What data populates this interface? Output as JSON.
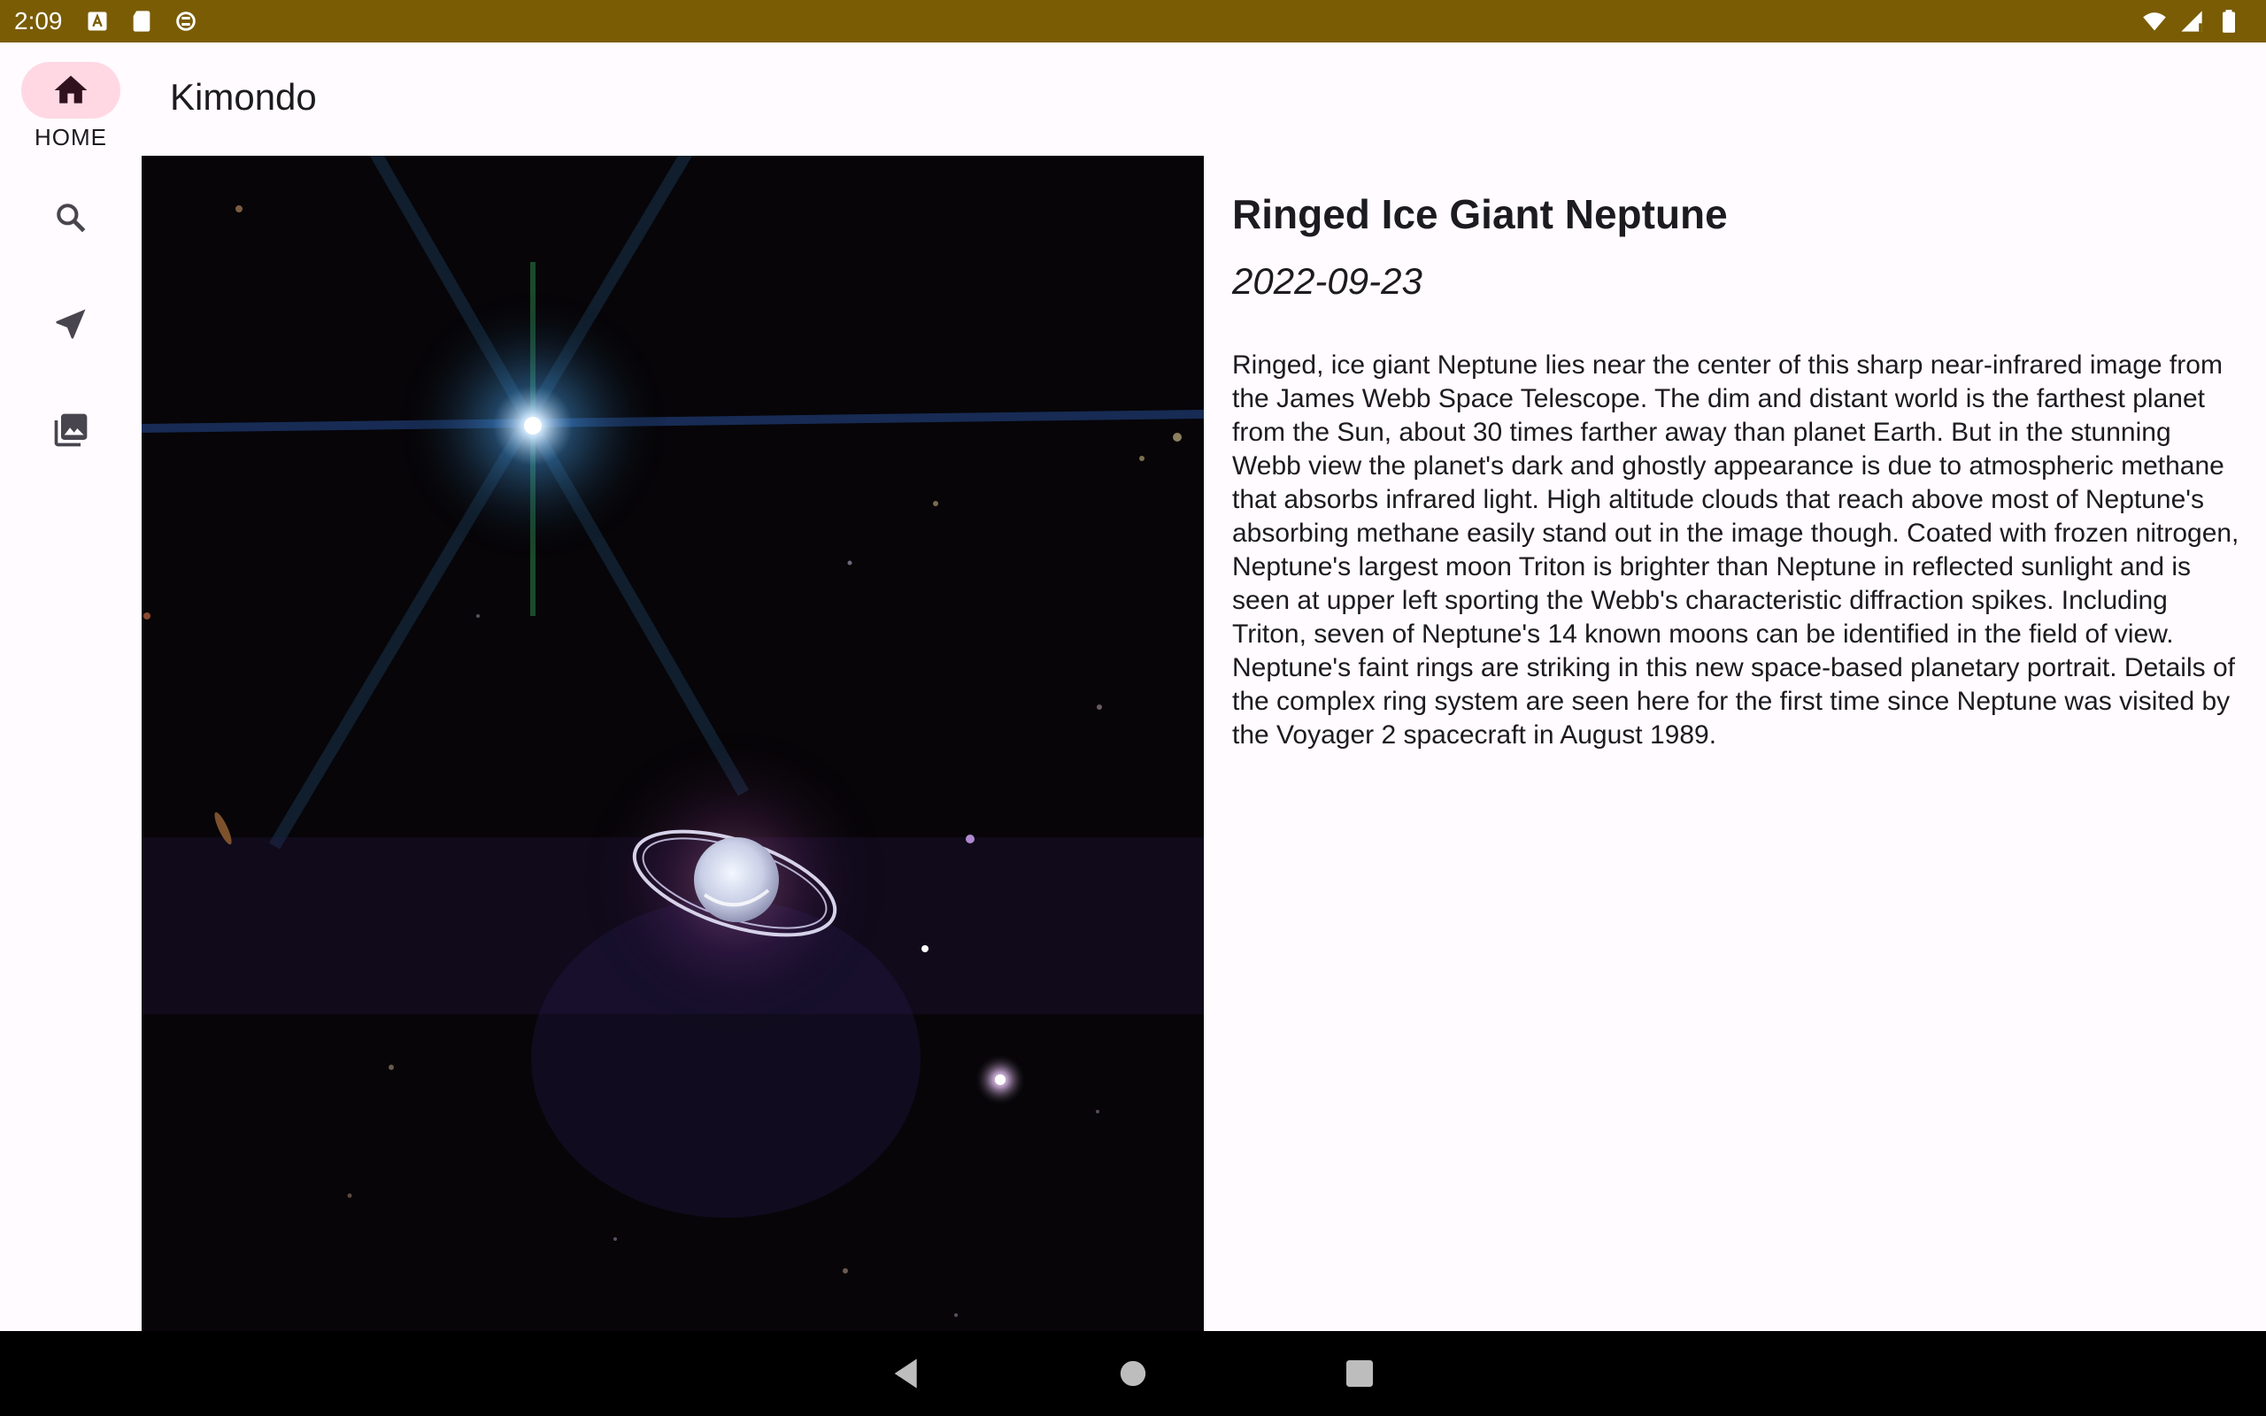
{
  "status_bar": {
    "time": "2:09",
    "left_icons": [
      "a-box-icon",
      "sd-card-icon",
      "sync-icon"
    ],
    "right_icons": [
      "wifi-icon",
      "signal-icon",
      "battery-icon"
    ],
    "background": "#7a5c04"
  },
  "app": {
    "title": "Kimondo"
  },
  "nav_rail": {
    "items": [
      {
        "id": "home",
        "label": "HOME",
        "icon": "home-icon",
        "active": true
      },
      {
        "id": "search",
        "label": "",
        "icon": "search-icon",
        "active": false
      },
      {
        "id": "location",
        "label": "",
        "icon": "navigation-arrow-icon",
        "active": false
      },
      {
        "id": "gallery",
        "label": "",
        "icon": "photo-library-icon",
        "active": false
      }
    ],
    "active_color": "#ffd8e4"
  },
  "detail": {
    "title": "Ringed Ice Giant Neptune",
    "date": "2022-09-23",
    "body": "Ringed, ice giant Neptune lies near the center of this sharp near-infrared image from the James Webb Space Telescope. The dim and distant world is the farthest planet from the Sun, about 30 times farther away than planet Earth. But in the stunning Webb view the planet's dark and ghostly appearance is due to atmospheric methane that absorbs infrared light. High altitude clouds that reach above most of Neptune's absorbing methane easily stand out in the image though. Coated with frozen nitrogen, Neptune's largest moon Triton is brighter than Neptune in reflected sunlight and is seen at upper left sporting the Webb's characteristic diffraction spikes. Including Triton, seven of Neptune's 14 known moons can be identified in the field of view. Neptune's faint rings are striking in this new space-based planetary portrait. Details of the complex ring system are seen here for the first time since Neptune was visited by the Voyager 2 spacecraft in August 1989."
  },
  "system_nav": {
    "buttons": [
      "back-icon",
      "home-circle-icon",
      "recents-icon"
    ]
  }
}
